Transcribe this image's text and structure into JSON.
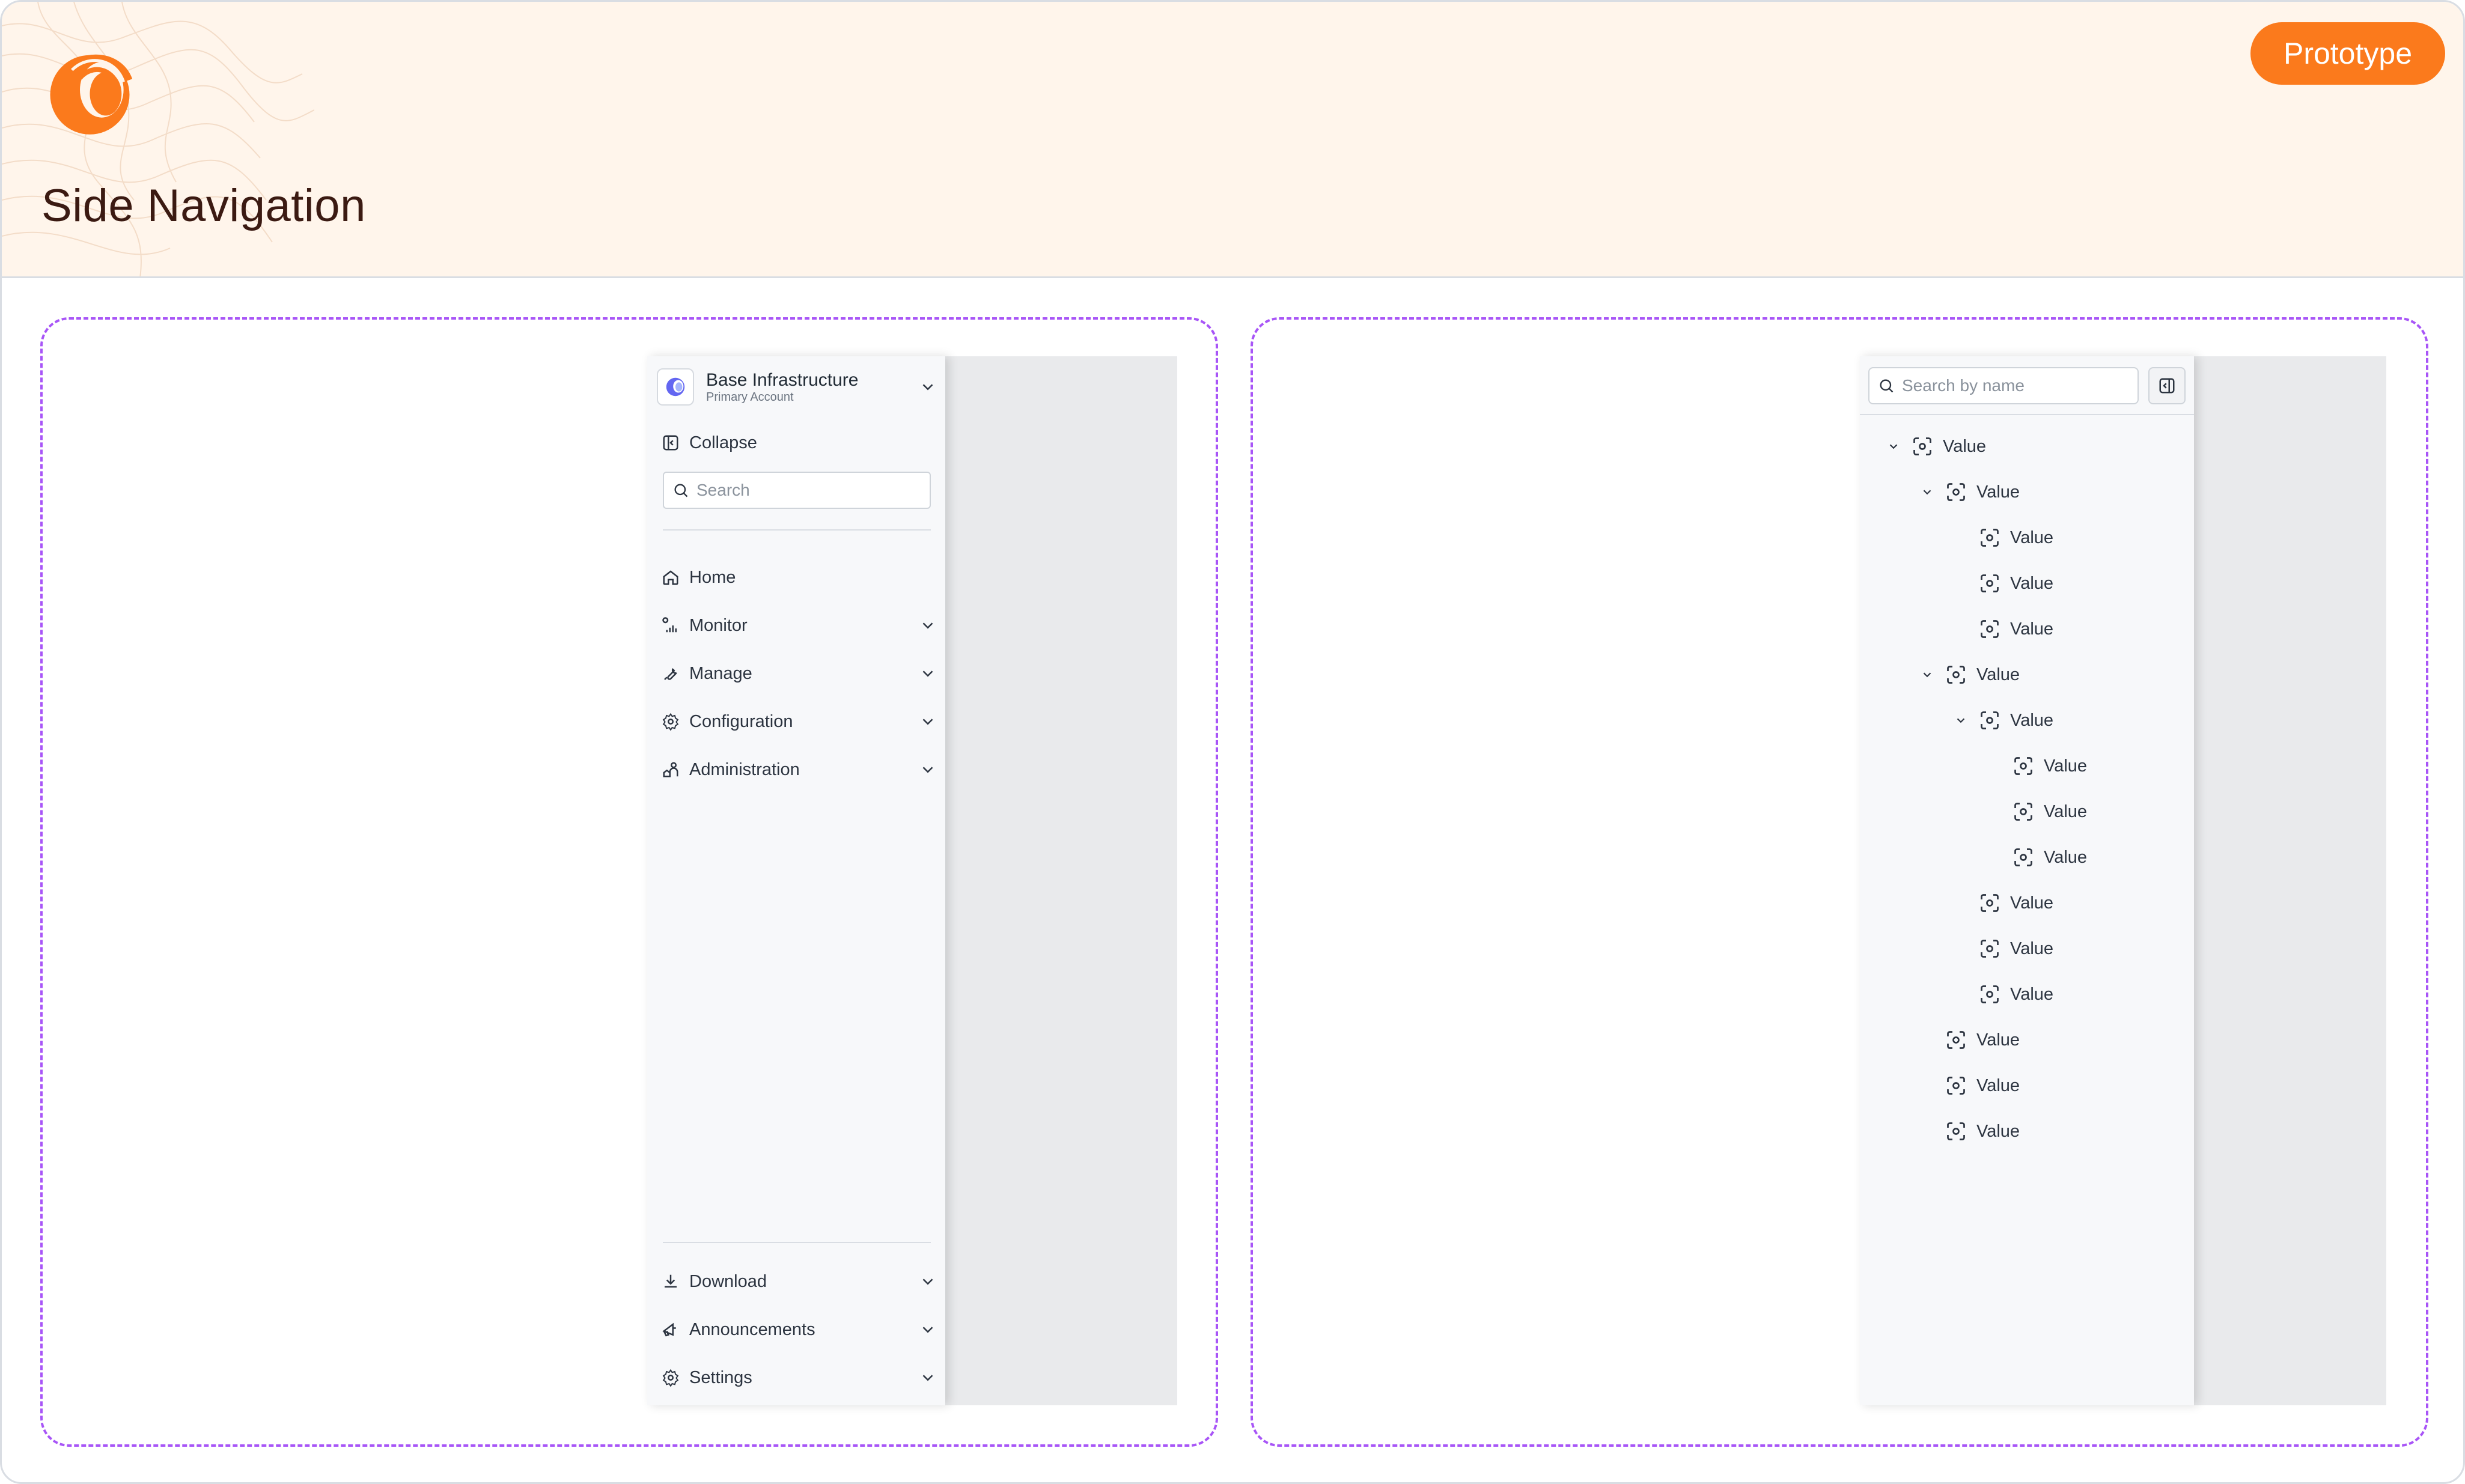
{
  "header": {
    "title": "Side Navigation",
    "badge": "Prototype",
    "brand_color": "#fb7a1c"
  },
  "sidebar": {
    "account": {
      "name": "Base Infrastructure",
      "subtitle": "Primary Account"
    },
    "collapse_label": "Collapse",
    "search_placeholder": "Search",
    "items": [
      {
        "label": "Home",
        "icon": "home-icon",
        "expandable": false
      },
      {
        "label": "Monitor",
        "icon": "monitor-chart-icon",
        "expandable": true
      },
      {
        "label": "Manage",
        "icon": "wrench-icon",
        "expandable": true
      },
      {
        "label": "Configuration",
        "icon": "gear-icon",
        "expandable": true
      },
      {
        "label": "Administration",
        "icon": "admin-users-icon",
        "expandable": true
      }
    ],
    "footer_items": [
      {
        "label": "Download",
        "icon": "download-icon",
        "expandable": true
      },
      {
        "label": "Announcements",
        "icon": "megaphone-icon",
        "expandable": true
      },
      {
        "label": "Settings",
        "icon": "settings-icon",
        "expandable": true
      }
    ]
  },
  "tree": {
    "search_placeholder": "Search by name",
    "collapse_icon": "sidebar-collapse-icon",
    "nodes": [
      {
        "label": "Value",
        "depth": 0,
        "expanded": true
      },
      {
        "label": "Value",
        "depth": 1,
        "expanded": true
      },
      {
        "label": "Value",
        "depth": 2
      },
      {
        "label": "Value",
        "depth": 2
      },
      {
        "label": "Value",
        "depth": 2
      },
      {
        "label": "Value",
        "depth": 1,
        "expanded": true
      },
      {
        "label": "Value",
        "depth": 2,
        "expanded": true
      },
      {
        "label": "Value",
        "depth": 3
      },
      {
        "label": "Value",
        "depth": 3
      },
      {
        "label": "Value",
        "depth": 3
      },
      {
        "label": "Value",
        "depth": 2
      },
      {
        "label": "Value",
        "depth": 2
      },
      {
        "label": "Value",
        "depth": 2
      },
      {
        "label": "Value",
        "depth": 1
      },
      {
        "label": "Value",
        "depth": 1
      },
      {
        "label": "Value",
        "depth": 1
      }
    ]
  }
}
